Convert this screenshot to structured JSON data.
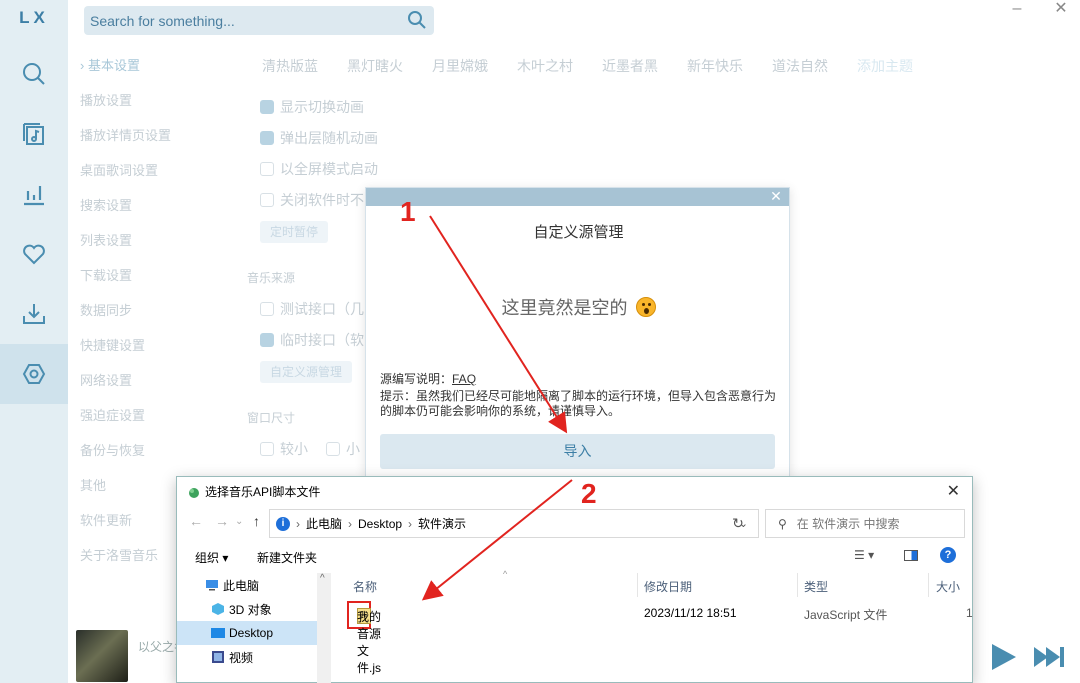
{
  "app": {
    "logo": "LX",
    "search_placeholder": "Search for something...",
    "window_minimize": "–",
    "window_close": "✕"
  },
  "rail": {
    "items": [
      "search-icon",
      "music-library-icon",
      "leaderboard-icon",
      "favorites-icon",
      "download-icon",
      "settings-icon"
    ],
    "active": "settings-icon"
  },
  "settings_nav": {
    "items": [
      "› 基本设置",
      "播放设置",
      "播放详情页设置",
      "桌面歌词设置",
      "搜索设置",
      "列表设置",
      "下载设置",
      "数据同步",
      "快捷键设置",
      "网络设置",
      "强迫症设置",
      "备份与恢复",
      "其他",
      "软件更新",
      "关于洛雪音乐"
    ]
  },
  "themes": [
    "清热版蓝",
    "黑灯瞎火",
    "月里嫦娥",
    "木叶之村",
    "近墨者黑",
    "新年快乐",
    "道法自然",
    "添加主题"
  ],
  "basic": {
    "opt1": "显示切换动画",
    "opt2": "弹出层随机动画",
    "opt3": "以全屏模式启动",
    "opt4": "关闭软件时不",
    "timer_pill": "定时暂停",
    "music_source_title": "音乐来源",
    "src1": "测试接口（几",
    "src2": "临时接口（软",
    "custom_src_pill": "自定义源管理",
    "window_size_title": "窗口尺寸",
    "size1": "较小",
    "size2": "小"
  },
  "player": {
    "song": "以父之名"
  },
  "custom_source_dialog": {
    "title": "自定义源管理",
    "empty_text": "这里竟然是空的",
    "faq_label": "源编写说明：",
    "faq_link": "FAQ",
    "tip": "提示：虽然我们已经尽可能地隔离了脚本的运行环境，但导入包含恶意行为的脚本仍可能会影响你的系统，请谨慎导入。",
    "import_button": "导入"
  },
  "file_dialog": {
    "title": "选择音乐API脚本文件",
    "breadcrumb": [
      "此电脑",
      "Desktop",
      "软件演示"
    ],
    "search_placeholder": "在 软件演示 中搜索",
    "organize": "组织 ▾",
    "new_folder": "新建文件夹",
    "tree": [
      "此电脑",
      "3D 对象",
      "Desktop",
      "视频"
    ],
    "tree_selected": "Desktop",
    "columns": [
      "名称",
      "修改日期",
      "类型",
      "大小"
    ],
    "files": [
      {
        "name": "我的音源文件.js",
        "date": "2023/11/12 18:51",
        "type": "JavaScript 文件",
        "size": "1"
      }
    ]
  },
  "annotations": {
    "step1": "1",
    "step2": "2",
    "color": "#e1241f"
  }
}
